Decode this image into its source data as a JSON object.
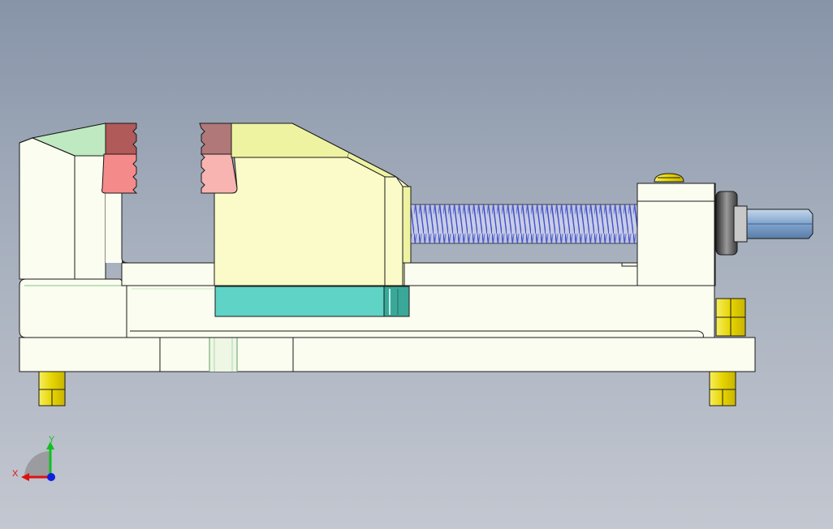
{
  "triad": {
    "x_label": "X",
    "y_label": "Y",
    "x_color": "#e01010",
    "y_color": "#10c020",
    "z_color": "#1020e0"
  },
  "colors": {
    "body": "#fbfdf0",
    "outline": "#1a1a1a",
    "fixed_jaw_top": "#bfe9c0",
    "movable_jaw": "#fafbc8",
    "movable_jaw_top": "#eef3a2",
    "jaw_plate_top": "#b05a5a",
    "jaw_plate_face": "#f58a8a",
    "slide_block": "#5ed3c6",
    "screw_thread": "#3848c8",
    "hex_nut": "#8fb3d8",
    "bolt": "#f0e020"
  }
}
